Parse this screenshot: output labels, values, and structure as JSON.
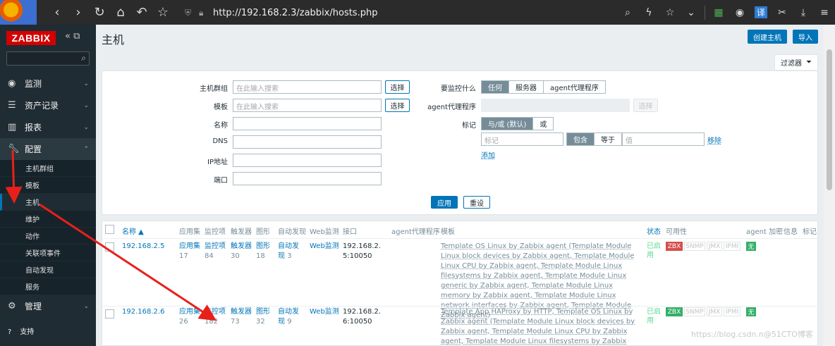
{
  "browser": {
    "url": "http://192.168.2.3/zabbix/hosts.php",
    "nav_icons": [
      "back-icon",
      "forward-icon",
      "reload-icon",
      "home-icon",
      "undo-icon",
      "bookmark-star-icon"
    ],
    "right_icons": [
      "search-icon",
      "bolt-icon",
      "star-icon",
      "chevron-down-icon",
      "apps-icon",
      "globe-icon",
      "translate-icon",
      "scissors-icon",
      "download-icon",
      "menu-icon"
    ],
    "translate_label": "译"
  },
  "sidebar": {
    "logo": "ZABBIX",
    "items": [
      {
        "label": "监测",
        "icon": "eye-icon"
      },
      {
        "label": "资产记录",
        "icon": "list-icon"
      },
      {
        "label": "报表",
        "icon": "chart-icon"
      },
      {
        "label": "配置",
        "icon": "wrench-icon"
      }
    ],
    "config_sub": [
      "主机群组",
      "模板",
      "主机",
      "维护",
      "动作",
      "关联项事件",
      "自动发现",
      "服务"
    ],
    "admin": {
      "label": "管理",
      "icon": "gear-icon"
    },
    "support": "支持"
  },
  "page": {
    "title": "主机",
    "create_btn": "创建主机",
    "import_btn": "导入",
    "filter_tab": "过滤器"
  },
  "filter": {
    "host_group_label": "主机群组",
    "template_label": "模板",
    "name_label": "名称",
    "dns_label": "DNS",
    "ip_label": "IP地址",
    "port_label": "端口",
    "placeholder": "在此输入搜索",
    "select_btn": "选择",
    "monitored_by_label": "要监控什么",
    "monitored_by": [
      "任何",
      "服务器",
      "agent代理程序"
    ],
    "proxy_label": "agent代理程序",
    "tags_label": "标记",
    "tag_mode": [
      "与/或 (默认)",
      "或"
    ],
    "tag_placeholder": "标记",
    "tag_ops": [
      "包含",
      "等于"
    ],
    "value_placeholder": "值",
    "remove": "移除",
    "add": "添加",
    "apply": "应用",
    "reset": "重设"
  },
  "table": {
    "headers": [
      "名称 ▲",
      "应用集",
      "监控项",
      "触发器",
      "图形",
      "自动发现",
      "Web监测",
      "接口",
      "agent代理程序",
      "模板",
      "状态",
      "可用性",
      "agent 加密",
      "信息",
      "标记"
    ],
    "rows": [
      {
        "name": "192.168.2.5",
        "apps": "应用集",
        "apps_n": "17",
        "items": "监控项",
        "items_n": "84",
        "triggers": "触发器",
        "triggers_n": "30",
        "graphs": "图形",
        "graphs_n": "18",
        "discovery": "自动发现",
        "discovery_n": "3",
        "web": "Web监测",
        "iface": "192.168.2.5:10050",
        "templates": "Template OS Linux by Zabbix agent (Template Module Linux block devices by Zabbix agent, Template Module Linux CPU by Zabbix agent, Template Module Linux filesystems by Zabbix agent, Template Module Linux generic by Zabbix agent, Template Module Linux memory by Zabbix agent, Template Module Linux network interfaces by Zabbix agent, Template Module Zabbix agent)",
        "status": "已启用",
        "zbx": "ZBX",
        "snmp": "SNMP",
        "jmx": "JMX",
        "ipmi": "IPMI",
        "encryption": "无"
      },
      {
        "name": "192.168.2.6",
        "apps": "应用集",
        "apps_n": "26",
        "items": "监控项",
        "items_n": "182",
        "triggers": "触发器",
        "triggers_n": "73",
        "graphs": "图形",
        "graphs_n": "32",
        "discovery": "自动发现",
        "discovery_n": "9",
        "web": "Web监测",
        "iface": "192.168.2.6:10050",
        "templates": "Template App HAProxy by HTTP, Template OS Linux by Zabbix agent (Template Module Linux block devices by Zabbix agent, Template Module Linux CPU by Zabbix agent, Template Module Linux filesystems by Zabbix agent, Template Module Linux generic",
        "status": "已启用",
        "zbx": "ZBX",
        "snmp": "SNMP",
        "jmx": "JMX",
        "ipmi": "IPMI",
        "encryption": "无"
      }
    ]
  },
  "watermark": "https://blog.csdn.n@51CTO博客",
  "colors": {
    "accent": "#0275b8",
    "logo": "#d40000",
    "sidebar": "#1f2c33",
    "annotation_arrow": "#e8201a"
  }
}
